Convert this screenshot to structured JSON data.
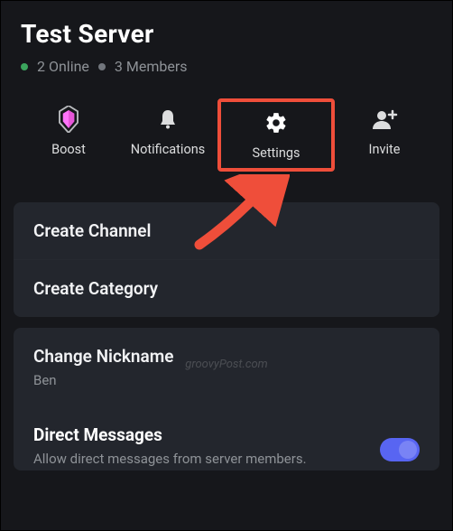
{
  "header": {
    "server_name": "Test Server",
    "online_count": "2 Online",
    "members_count": "3 Members"
  },
  "actions": {
    "boost": "Boost",
    "notifications": "Notifications",
    "settings": "Settings",
    "invite": "Invite"
  },
  "section1": {
    "create_channel": "Create Channel",
    "create_category": "Create Category"
  },
  "section2": {
    "change_nickname_title": "Change Nickname",
    "change_nickname_value": "Ben",
    "dm_title": "Direct Messages",
    "dm_sub": "Allow direct messages from server members."
  },
  "watermark": "groovyPost.com",
  "colors": {
    "highlight": "#ef4e3a",
    "toggle_on": "#5865f2"
  }
}
